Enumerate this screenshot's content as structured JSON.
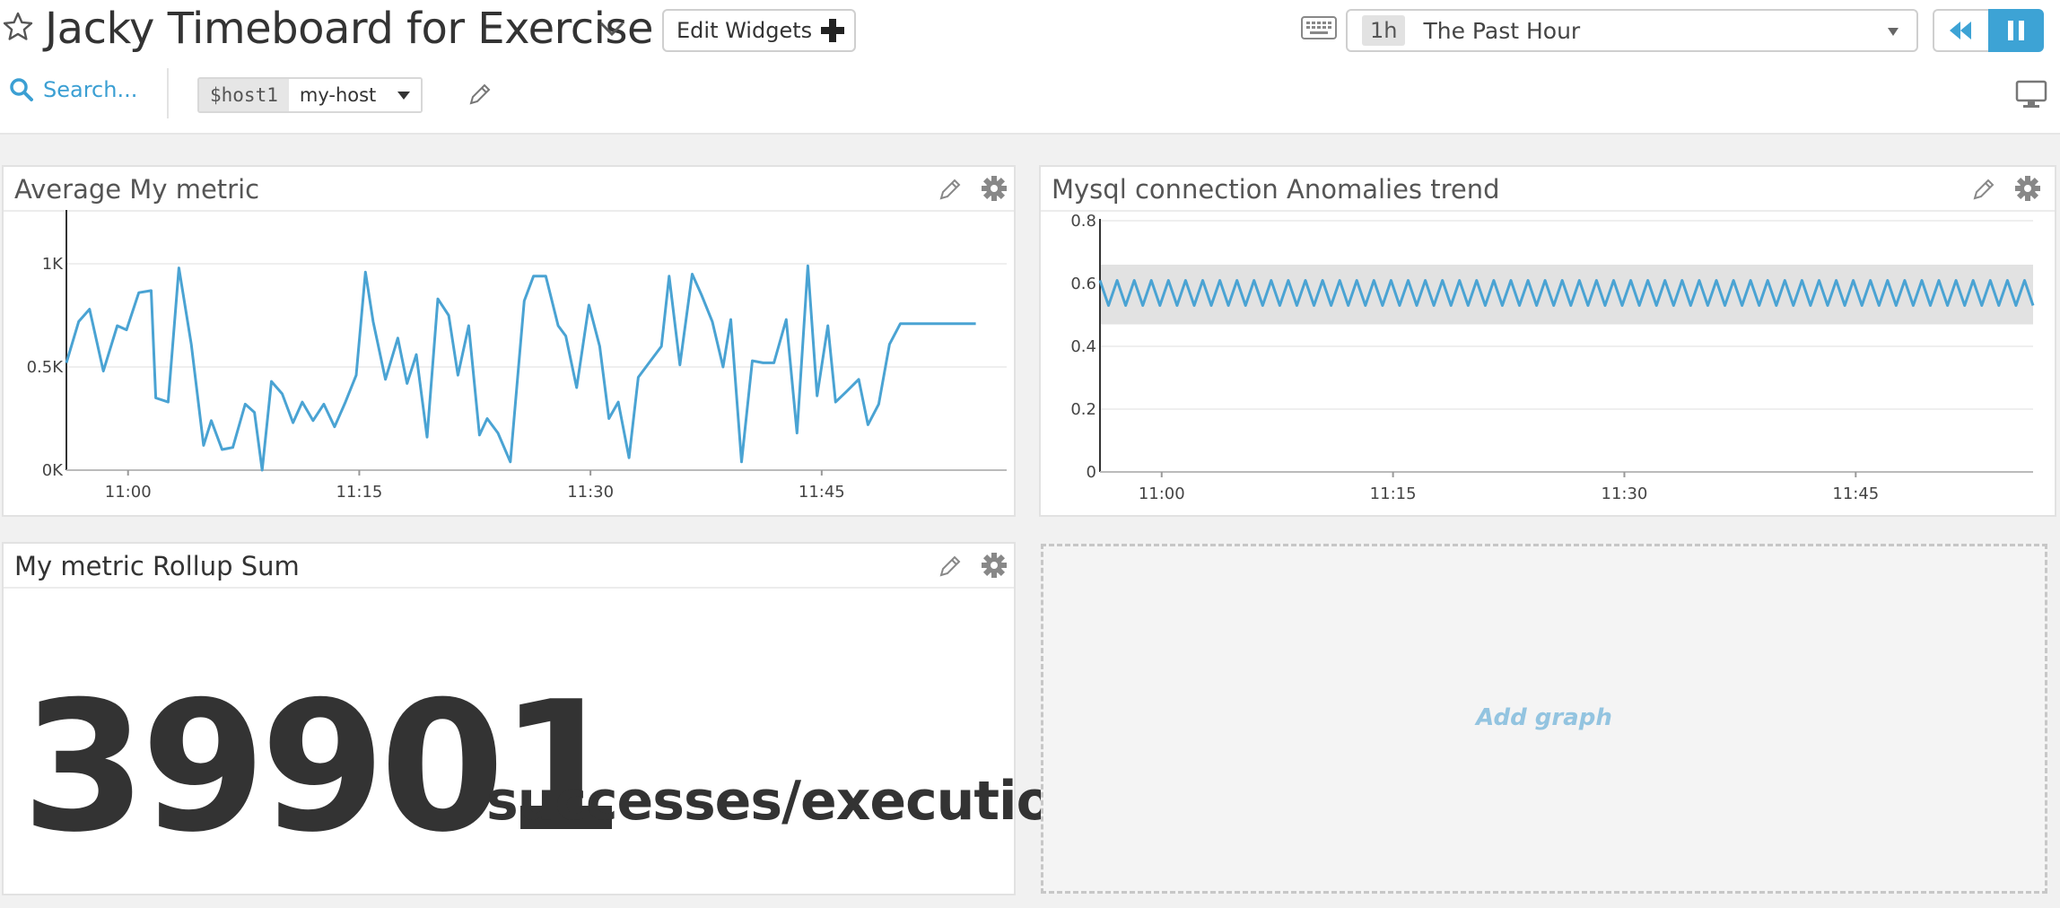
{
  "header": {
    "title": "Jacky Timeboard for Exercise",
    "edit_widgets_label": "Edit Widgets",
    "time_badge": "1h",
    "time_label": "The Past Hour"
  },
  "toolbar": {
    "search_label": "Search...",
    "template_var_name": "$host1",
    "template_var_value": "my-host"
  },
  "widgets": {
    "avg_metric": {
      "title": "Average My metric"
    },
    "mysql": {
      "title": "Mysql connection Anomalies trend"
    },
    "rollup": {
      "title": "My metric Rollup Sum",
      "value": "39901",
      "unit": "successes/execution"
    },
    "add_graph": {
      "label": "Add graph"
    }
  },
  "colors": {
    "accent": "#3da3d5",
    "line": "#4aa3d3",
    "band": "#e2e2e2"
  },
  "chart_data": [
    {
      "type": "line",
      "title": "Average My metric",
      "x_ticks": [
        "11:00",
        "11:15",
        "11:30",
        "11:45"
      ],
      "y_ticks": [
        "0K",
        "0.5K",
        "1K"
      ],
      "xlim_minutes": [
        56,
        117
      ],
      "ylim": [
        0,
        1200
      ],
      "grid": true,
      "series": [
        {
          "x": [
            56.0,
            56.8,
            57.5,
            58.4,
            59.3,
            59.9,
            60.7,
            61.5,
            61.8,
            62.6,
            63.3,
            64.1,
            64.9,
            65.4,
            66.1,
            66.8,
            67.6,
            68.2,
            68.7,
            69.3,
            70.0,
            70.7,
            71.3,
            72.0,
            72.7,
            73.4,
            74.1,
            74.8,
            75.4,
            75.9,
            76.7,
            77.5,
            78.1,
            78.7,
            79.4,
            80.1,
            80.8,
            81.4,
            82.1,
            82.8,
            83.3,
            84.0,
            84.8,
            85.7,
            86.3,
            87.1,
            87.9,
            88.4,
            89.1,
            89.9,
            90.6,
            91.2,
            91.8,
            92.5,
            93.1,
            93.8,
            94.6,
            95.1,
            95.8,
            96.6,
            97.2,
            97.9,
            98.6,
            99.1,
            99.8,
            100.5,
            101.2,
            101.9,
            102.7,
            103.4,
            104.1,
            104.7,
            105.4,
            105.9,
            106.6,
            107.4,
            108.0,
            108.7,
            109.4,
            110.1,
            110.8,
            111.4,
            112.1,
            112.8,
            113.6,
            114.3,
            115.0
          ],
          "y": [
            520,
            720,
            780,
            480,
            700,
            680,
            860,
            870,
            350,
            330,
            980,
            610,
            120,
            240,
            100,
            110,
            320,
            280,
            0,
            430,
            370,
            230,
            330,
            240,
            320,
            210,
            330,
            460,
            960,
            720,
            440,
            640,
            420,
            560,
            160,
            830,
            750,
            460,
            700,
            170,
            250,
            180,
            40,
            820,
            940,
            940,
            700,
            650,
            400,
            800,
            600,
            250,
            330,
            60,
            450,
            520,
            600,
            940,
            510,
            950,
            850,
            720,
            500,
            730,
            40,
            530,
            520,
            520,
            730,
            180,
            990,
            360,
            700,
            330,
            380,
            440,
            220,
            320,
            610,
            710,
            710,
            710,
            710,
            710,
            710,
            710,
            710
          ]
        }
      ]
    },
    {
      "type": "line",
      "title": "Mysql connection Anomalies trend",
      "x_ticks": [
        "11:00",
        "11:15",
        "11:30",
        "11:45"
      ],
      "y_ticks": [
        "0",
        "0.2",
        "0.4",
        "0.6",
        "0.8"
      ],
      "xlim_minutes": [
        56,
        116.5
      ],
      "ylim": [
        0,
        0.8
      ],
      "grid": true,
      "band": {
        "low": 0.47,
        "high": 0.66
      },
      "series": [
        {
          "name": "",
          "pattern": "oscillating",
          "low": 0.53,
          "high": 0.61,
          "points": 110
        }
      ]
    }
  ]
}
